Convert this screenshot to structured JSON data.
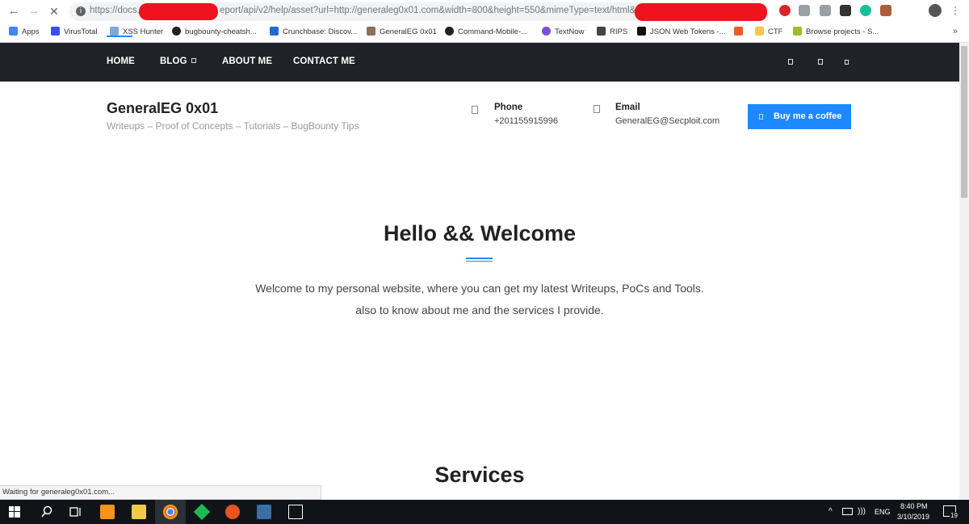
{
  "browser": {
    "back": "←",
    "forward": "→",
    "reload": "✕",
    "url_prefix": "https://docs.",
    "url_middle": "eport/api/v2/help/asset?url=http://generaleg0x01.com&width=800&height=550&mimeType=text/html&",
    "bookmarks": [
      {
        "label": "Apps",
        "color": "#4285f4"
      },
      {
        "label": "VirusTotal",
        "color": "#394eff"
      },
      {
        "label": "XSS Hunter",
        "color": "#7fa7d9"
      },
      {
        "label": "bugbounty-cheatsh...",
        "color": "#222222"
      },
      {
        "label": "Crunchbase: Discov...",
        "color": "#1f6bd1"
      },
      {
        "label": "GeneralEG 0x01",
        "color": "#8a6f5a"
      },
      {
        "label": "Command-Mobile-...",
        "color": "#222222"
      },
      {
        "label": "TextNow",
        "color": "#7a4fd6"
      },
      {
        "label": "RIPS",
        "color": "#444444"
      },
      {
        "label": "JSON Web Tokens -...",
        "color": "#111111"
      },
      {
        "label": "",
        "color": "#f05a28"
      },
      {
        "label": "CTF",
        "color": "#f3c84b"
      },
      {
        "label": "Browse projects - S...",
        "color": "#9bbf2a"
      }
    ],
    "more": "»"
  },
  "nav": {
    "items": [
      {
        "label": "HOME"
      },
      {
        "label": "BLOG"
      },
      {
        "label": "ABOUT ME"
      },
      {
        "label": "CONTACT ME"
      }
    ]
  },
  "header": {
    "title": "GeneralEG 0x01",
    "tagline": "Writeups – Proof of Concepts – Tutorials – BugBounty Tips",
    "phone_label": "Phone",
    "phone_value": "+201155915996",
    "email_label": "Email",
    "email_value": "GeneralEG@Secploit.com",
    "cta_label": "Buy me a coffee"
  },
  "hero": {
    "title": "Hello && Welcome",
    "line1": "Welcome to my personal website, where you can get my latest Writeups, PoCs and Tools.",
    "line2": "also to know about me and the services I provide."
  },
  "services": {
    "title": "Services"
  },
  "status_text": "Waiting for generaleg0x01.com...",
  "taskbar": {
    "lang": "ENG",
    "time": "8:40 PM",
    "date": "3/10/2019",
    "notifications": "19"
  },
  "colors": {
    "accent": "#1e88ff",
    "nav_bg": "#1f2226"
  }
}
